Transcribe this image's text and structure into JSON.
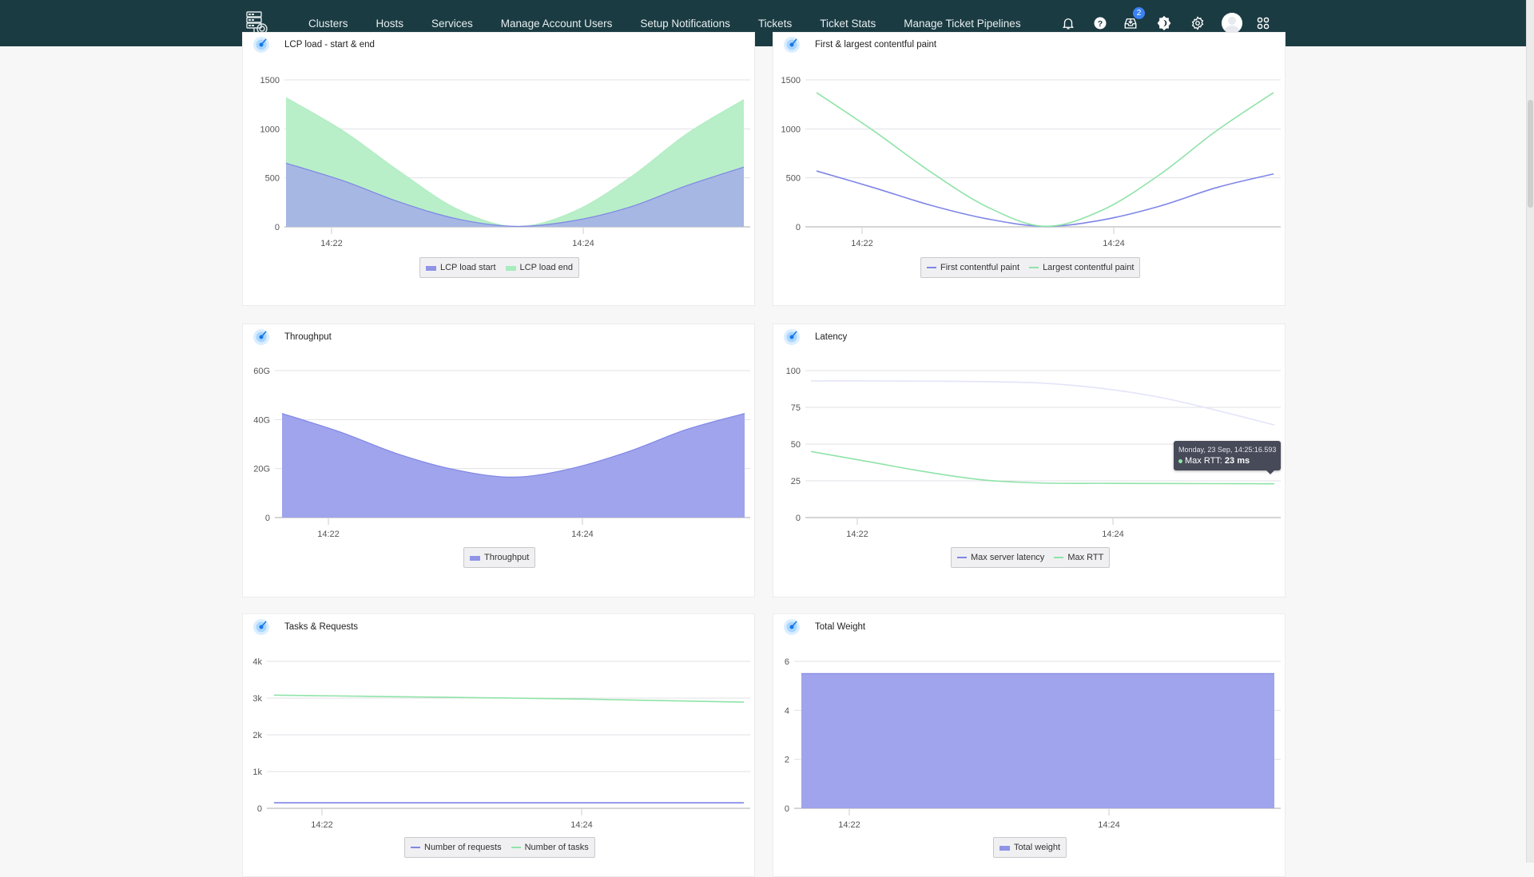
{
  "nav": {
    "items": [
      "Clusters",
      "Hosts",
      "Services",
      "Manage Account Users",
      "Setup Notifications",
      "Tickets",
      "Ticket Stats",
      "Manage Ticket Pipelines"
    ],
    "inbox_badge": "2",
    "icons": [
      "bell-icon",
      "help-icon",
      "inbox-icon",
      "theme-toggle-icon",
      "gear-icon",
      "avatar",
      "apps-grid-icon"
    ]
  },
  "colors": {
    "topbar": "#1b3b42",
    "series_purple": "#7f86e6",
    "series_green": "#8fe3a8",
    "area_purple_fill": "#a0a4ec",
    "area_green_fill": "#b8efc8",
    "tooltip_bg": "#474a59"
  },
  "chart_data": [
    {
      "id": "lcp",
      "title": "LCP load - start & end",
      "type": "area",
      "x": [
        "14:21:30",
        "14:22",
        "14:22:30",
        "14:23",
        "14:23:30",
        "14:24",
        "14:24:30",
        "14:25",
        "14:25:20"
      ],
      "xticks": [
        "14:22",
        "14:24"
      ],
      "yticks": [
        "0",
        "500",
        "1000",
        "1500"
      ],
      "ylim": [
        0,
        1500
      ],
      "series": [
        {
          "name": "LCP load start",
          "values": [
            650,
            470,
            250,
            80,
            5,
            60,
            200,
            420,
            610
          ]
        },
        {
          "name": "LCP load end",
          "values": [
            1320,
            980,
            560,
            180,
            5,
            150,
            500,
            950,
            1300
          ]
        }
      ],
      "legend": "bottom-center"
    },
    {
      "id": "paint",
      "title": "First & largest contentful paint",
      "type": "line",
      "x": [
        "14:21:30",
        "14:22",
        "14:22:30",
        "14:23",
        "14:23:30",
        "14:24",
        "14:24:30",
        "14:25",
        "14:25:20"
      ],
      "xticks": [
        "14:22",
        "14:24"
      ],
      "yticks": [
        "0",
        "500",
        "1000",
        "1500"
      ],
      "ylim": [
        0,
        1500
      ],
      "series": [
        {
          "name": "First contentful paint",
          "values": [
            570,
            400,
            220,
            80,
            5,
            70,
            210,
            400,
            540
          ]
        },
        {
          "name": "Largest contentful paint",
          "values": [
            1370,
            980,
            560,
            200,
            5,
            170,
            530,
            980,
            1370
          ]
        }
      ],
      "legend": "bottom-center"
    },
    {
      "id": "throughput",
      "title": "Throughput",
      "type": "area",
      "x": [
        "14:21:30",
        "14:22",
        "14:22:30",
        "14:23",
        "14:23:30",
        "14:24",
        "14:24:30",
        "14:25",
        "14:25:20"
      ],
      "xticks": [
        "14:22",
        "14:24"
      ],
      "yticks": [
        "0",
        "20G",
        "40G",
        "60G"
      ],
      "ylim": [
        0,
        60
      ],
      "unit": "G",
      "series": [
        {
          "name": "Throughput",
          "values": [
            42.5,
            35,
            26,
            19.5,
            16.5,
            20,
            27,
            36,
            42.5
          ]
        }
      ],
      "legend": "bottom-center"
    },
    {
      "id": "latency",
      "title": "Latency",
      "type": "line",
      "x": [
        "14:21:30",
        "14:22",
        "14:22:30",
        "14:23",
        "14:23:30",
        "14:24",
        "14:24:30",
        "14:25",
        "14:25:20"
      ],
      "xticks": [
        "14:22",
        "14:24"
      ],
      "yticks": [
        "0",
        "25",
        "50",
        "75",
        "100"
      ],
      "ylim": [
        0,
        100
      ],
      "series": [
        {
          "name": "Max server latency",
          "values": [
            93,
            93,
            92.8,
            92.5,
            91.5,
            88,
            82,
            73,
            63
          ]
        },
        {
          "name": "Max RTT",
          "values": [
            45,
            38,
            31,
            25.5,
            23.5,
            23.3,
            23.2,
            23.1,
            23
          ]
        }
      ],
      "tooltip": {
        "time": "Monday, 23 Sep, 14:25:16.593",
        "series": "Max RTT",
        "label": "Max RTT: ",
        "value": "23 ms"
      },
      "legend": "bottom-center"
    },
    {
      "id": "tasks",
      "title": "Tasks & Requests",
      "type": "line",
      "x": [
        "14:21:30",
        "14:22",
        "14:22:30",
        "14:23",
        "14:23:30",
        "14:24",
        "14:24:30",
        "14:25",
        "14:25:20"
      ],
      "xticks": [
        "14:22",
        "14:24"
      ],
      "yticks": [
        "0",
        "1k",
        "2k",
        "3k",
        "4k"
      ],
      "ylim": [
        0,
        4000
      ],
      "series": [
        {
          "name": "Number of requests",
          "values": [
            150,
            150,
            150,
            150,
            150,
            150,
            150,
            150,
            150
          ]
        },
        {
          "name": "Number of tasks",
          "values": [
            3080,
            3060,
            3040,
            3020,
            3000,
            2980,
            2950,
            2920,
            2890
          ]
        }
      ],
      "legend": "bottom-center"
    },
    {
      "id": "weight",
      "title": "Total Weight",
      "type": "area",
      "x": [
        "14:21:30",
        "14:22",
        "14:22:30",
        "14:23",
        "14:23:30",
        "14:24",
        "14:24:30",
        "14:25",
        "14:25:20"
      ],
      "xticks": [
        "14:22",
        "14:24"
      ],
      "yticks": [
        "0",
        "2",
        "4",
        "6"
      ],
      "ylim": [
        0,
        6
      ],
      "series": [
        {
          "name": "Total weight",
          "values": [
            5.5,
            5.5,
            5.5,
            5.5,
            5.5,
            5.5,
            5.5,
            5.5,
            5.5
          ]
        }
      ],
      "legend": "bottom-center"
    }
  ]
}
